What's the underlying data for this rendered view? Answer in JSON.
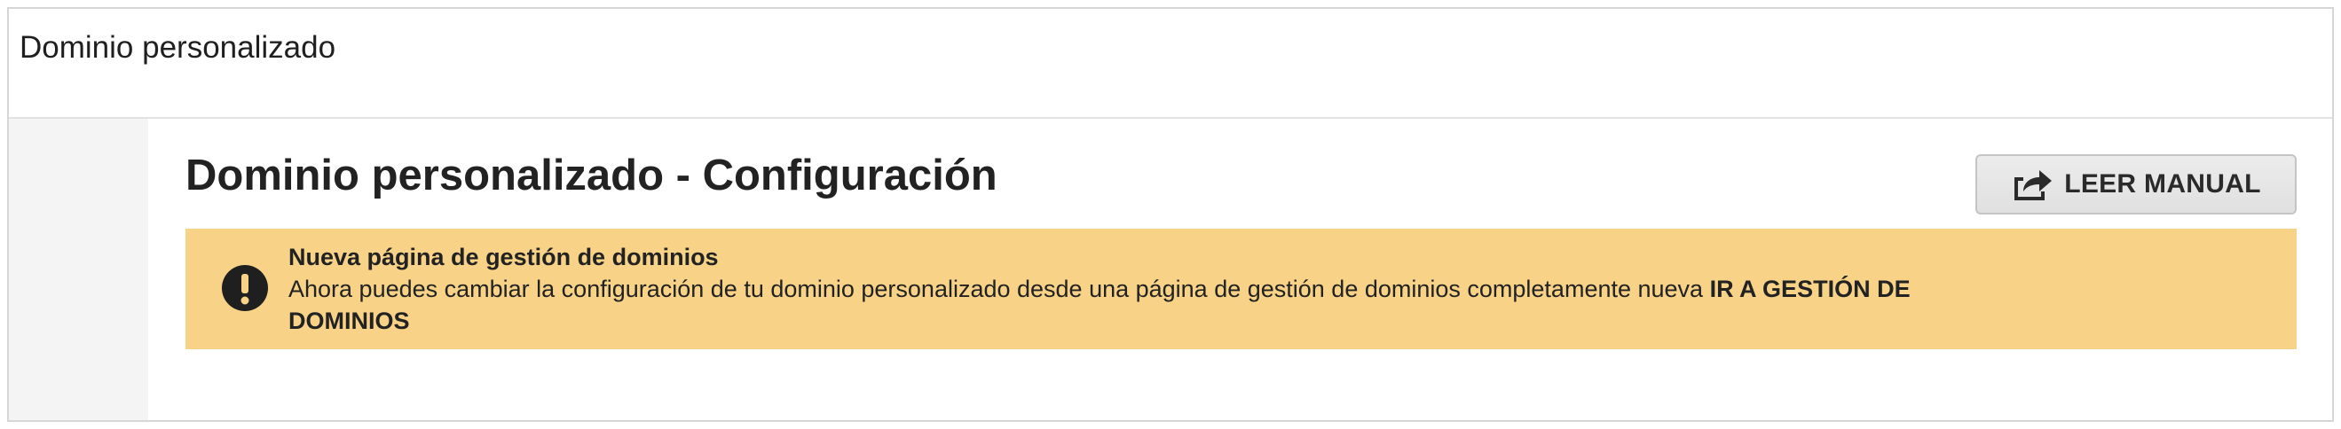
{
  "header": {
    "title": "Dominio personalizado"
  },
  "main": {
    "title": "Dominio personalizado - Configuración",
    "manual_button": {
      "label": "LEER MANUAL",
      "icon": "share-arrow-icon"
    }
  },
  "alert": {
    "icon": "exclamation-circle-icon",
    "title": "Nueva página de gestión de dominios",
    "body": "Ahora puedes cambiar la configuración de tu dominio personalizado desde una página de gestión de dominios completamente nueva",
    "link_label": "IR A GESTIÓN DE DOMINIOS",
    "background_color": "#f8d387"
  }
}
